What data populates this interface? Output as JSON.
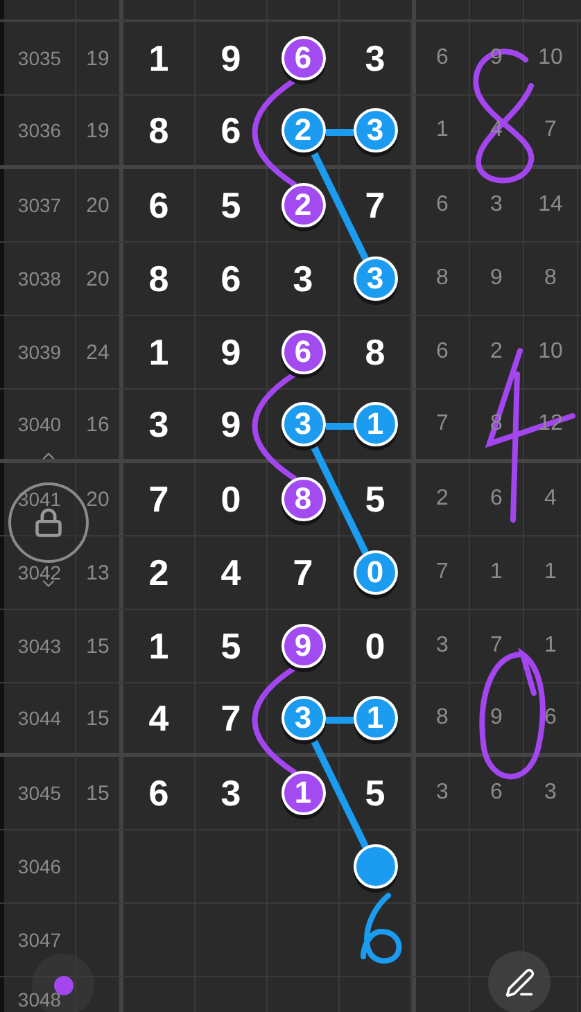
{
  "rows": [
    {
      "issue": "3035",
      "sum": "19",
      "digits": [
        {
          "kind": "digit",
          "text": "1"
        },
        {
          "kind": "digit",
          "text": "9"
        },
        {
          "kind": "ball",
          "text": "6",
          "color": "#a24bf0"
        },
        {
          "kind": "digit",
          "text": "3"
        }
      ],
      "extra": [
        "6",
        "9",
        "10"
      ]
    },
    {
      "issue": "3036",
      "sum": "19",
      "digits": [
        {
          "kind": "digit",
          "text": "8"
        },
        {
          "kind": "digit",
          "text": "6"
        },
        {
          "kind": "ball",
          "text": "2",
          "color": "#1b9cf0"
        },
        {
          "kind": "ball",
          "text": "3",
          "color": "#1b9cf0"
        }
      ],
      "extra": [
        "1",
        "4",
        "7"
      ]
    },
    {
      "issue": "3037",
      "sum": "20",
      "digits": [
        {
          "kind": "digit",
          "text": "6"
        },
        {
          "kind": "digit",
          "text": "5"
        },
        {
          "kind": "ball",
          "text": "2",
          "color": "#a24bf0"
        },
        {
          "kind": "digit",
          "text": "7"
        }
      ],
      "extra": [
        "6",
        "3",
        "14"
      ]
    },
    {
      "issue": "3038",
      "sum": "20",
      "digits": [
        {
          "kind": "digit",
          "text": "8"
        },
        {
          "kind": "digit",
          "text": "6"
        },
        {
          "kind": "digit",
          "text": "3"
        },
        {
          "kind": "ball",
          "text": "3",
          "color": "#1b9cf0"
        }
      ],
      "extra": [
        "8",
        "9",
        "8"
      ]
    },
    {
      "issue": "3039",
      "sum": "24",
      "digits": [
        {
          "kind": "digit",
          "text": "1"
        },
        {
          "kind": "digit",
          "text": "9"
        },
        {
          "kind": "ball",
          "text": "6",
          "color": "#a24bf0"
        },
        {
          "kind": "digit",
          "text": "8"
        }
      ],
      "extra": [
        "6",
        "2",
        "10"
      ]
    },
    {
      "issue": "3040",
      "sum": "16",
      "digits": [
        {
          "kind": "digit",
          "text": "3"
        },
        {
          "kind": "digit",
          "text": "9"
        },
        {
          "kind": "ball",
          "text": "3",
          "color": "#1b9cf0"
        },
        {
          "kind": "ball",
          "text": "1",
          "color": "#1b9cf0"
        }
      ],
      "extra": [
        "7",
        "8",
        "12"
      ]
    },
    {
      "issue": "3041",
      "sum": "20",
      "digits": [
        {
          "kind": "digit",
          "text": "7"
        },
        {
          "kind": "digit",
          "text": "0"
        },
        {
          "kind": "ball",
          "text": "8",
          "color": "#a24bf0"
        },
        {
          "kind": "digit",
          "text": "5"
        }
      ],
      "extra": [
        "2",
        "6",
        "4"
      ]
    },
    {
      "issue": "3042",
      "sum": "13",
      "digits": [
        {
          "kind": "digit",
          "text": "2"
        },
        {
          "kind": "digit",
          "text": "4"
        },
        {
          "kind": "digit",
          "text": "7"
        },
        {
          "kind": "ball",
          "text": "0",
          "color": "#1b9cf0"
        }
      ],
      "extra": [
        "7",
        "1",
        "1"
      ]
    },
    {
      "issue": "3043",
      "sum": "15",
      "digits": [
        {
          "kind": "digit",
          "text": "1"
        },
        {
          "kind": "digit",
          "text": "5"
        },
        {
          "kind": "ball",
          "text": "9",
          "color": "#a24bf0"
        },
        {
          "kind": "digit",
          "text": "0"
        }
      ],
      "extra": [
        "3",
        "7",
        "1"
      ]
    },
    {
      "issue": "3044",
      "sum": "15",
      "digits": [
        {
          "kind": "digit",
          "text": "4"
        },
        {
          "kind": "digit",
          "text": "7"
        },
        {
          "kind": "ball",
          "text": "3",
          "color": "#1b9cf0"
        },
        {
          "kind": "ball",
          "text": "1",
          "color": "#1b9cf0"
        }
      ],
      "extra": [
        "8",
        "9",
        "6"
      ]
    },
    {
      "issue": "3045",
      "sum": "15",
      "digits": [
        {
          "kind": "digit",
          "text": "6"
        },
        {
          "kind": "digit",
          "text": "3"
        },
        {
          "kind": "ball",
          "text": "1",
          "color": "#a24bf0"
        },
        {
          "kind": "digit",
          "text": "5"
        }
      ],
      "extra": [
        "3",
        "6",
        "3"
      ]
    },
    {
      "issue": "3046",
      "digits": [
        {
          "kind": "blank"
        },
        {
          "kind": "blank"
        },
        {
          "kind": "blank"
        },
        {
          "kind": "ball",
          "color": "#1b9cf0"
        }
      ]
    },
    {
      "issue": "3047"
    },
    {
      "issue": "3048"
    }
  ]
}
